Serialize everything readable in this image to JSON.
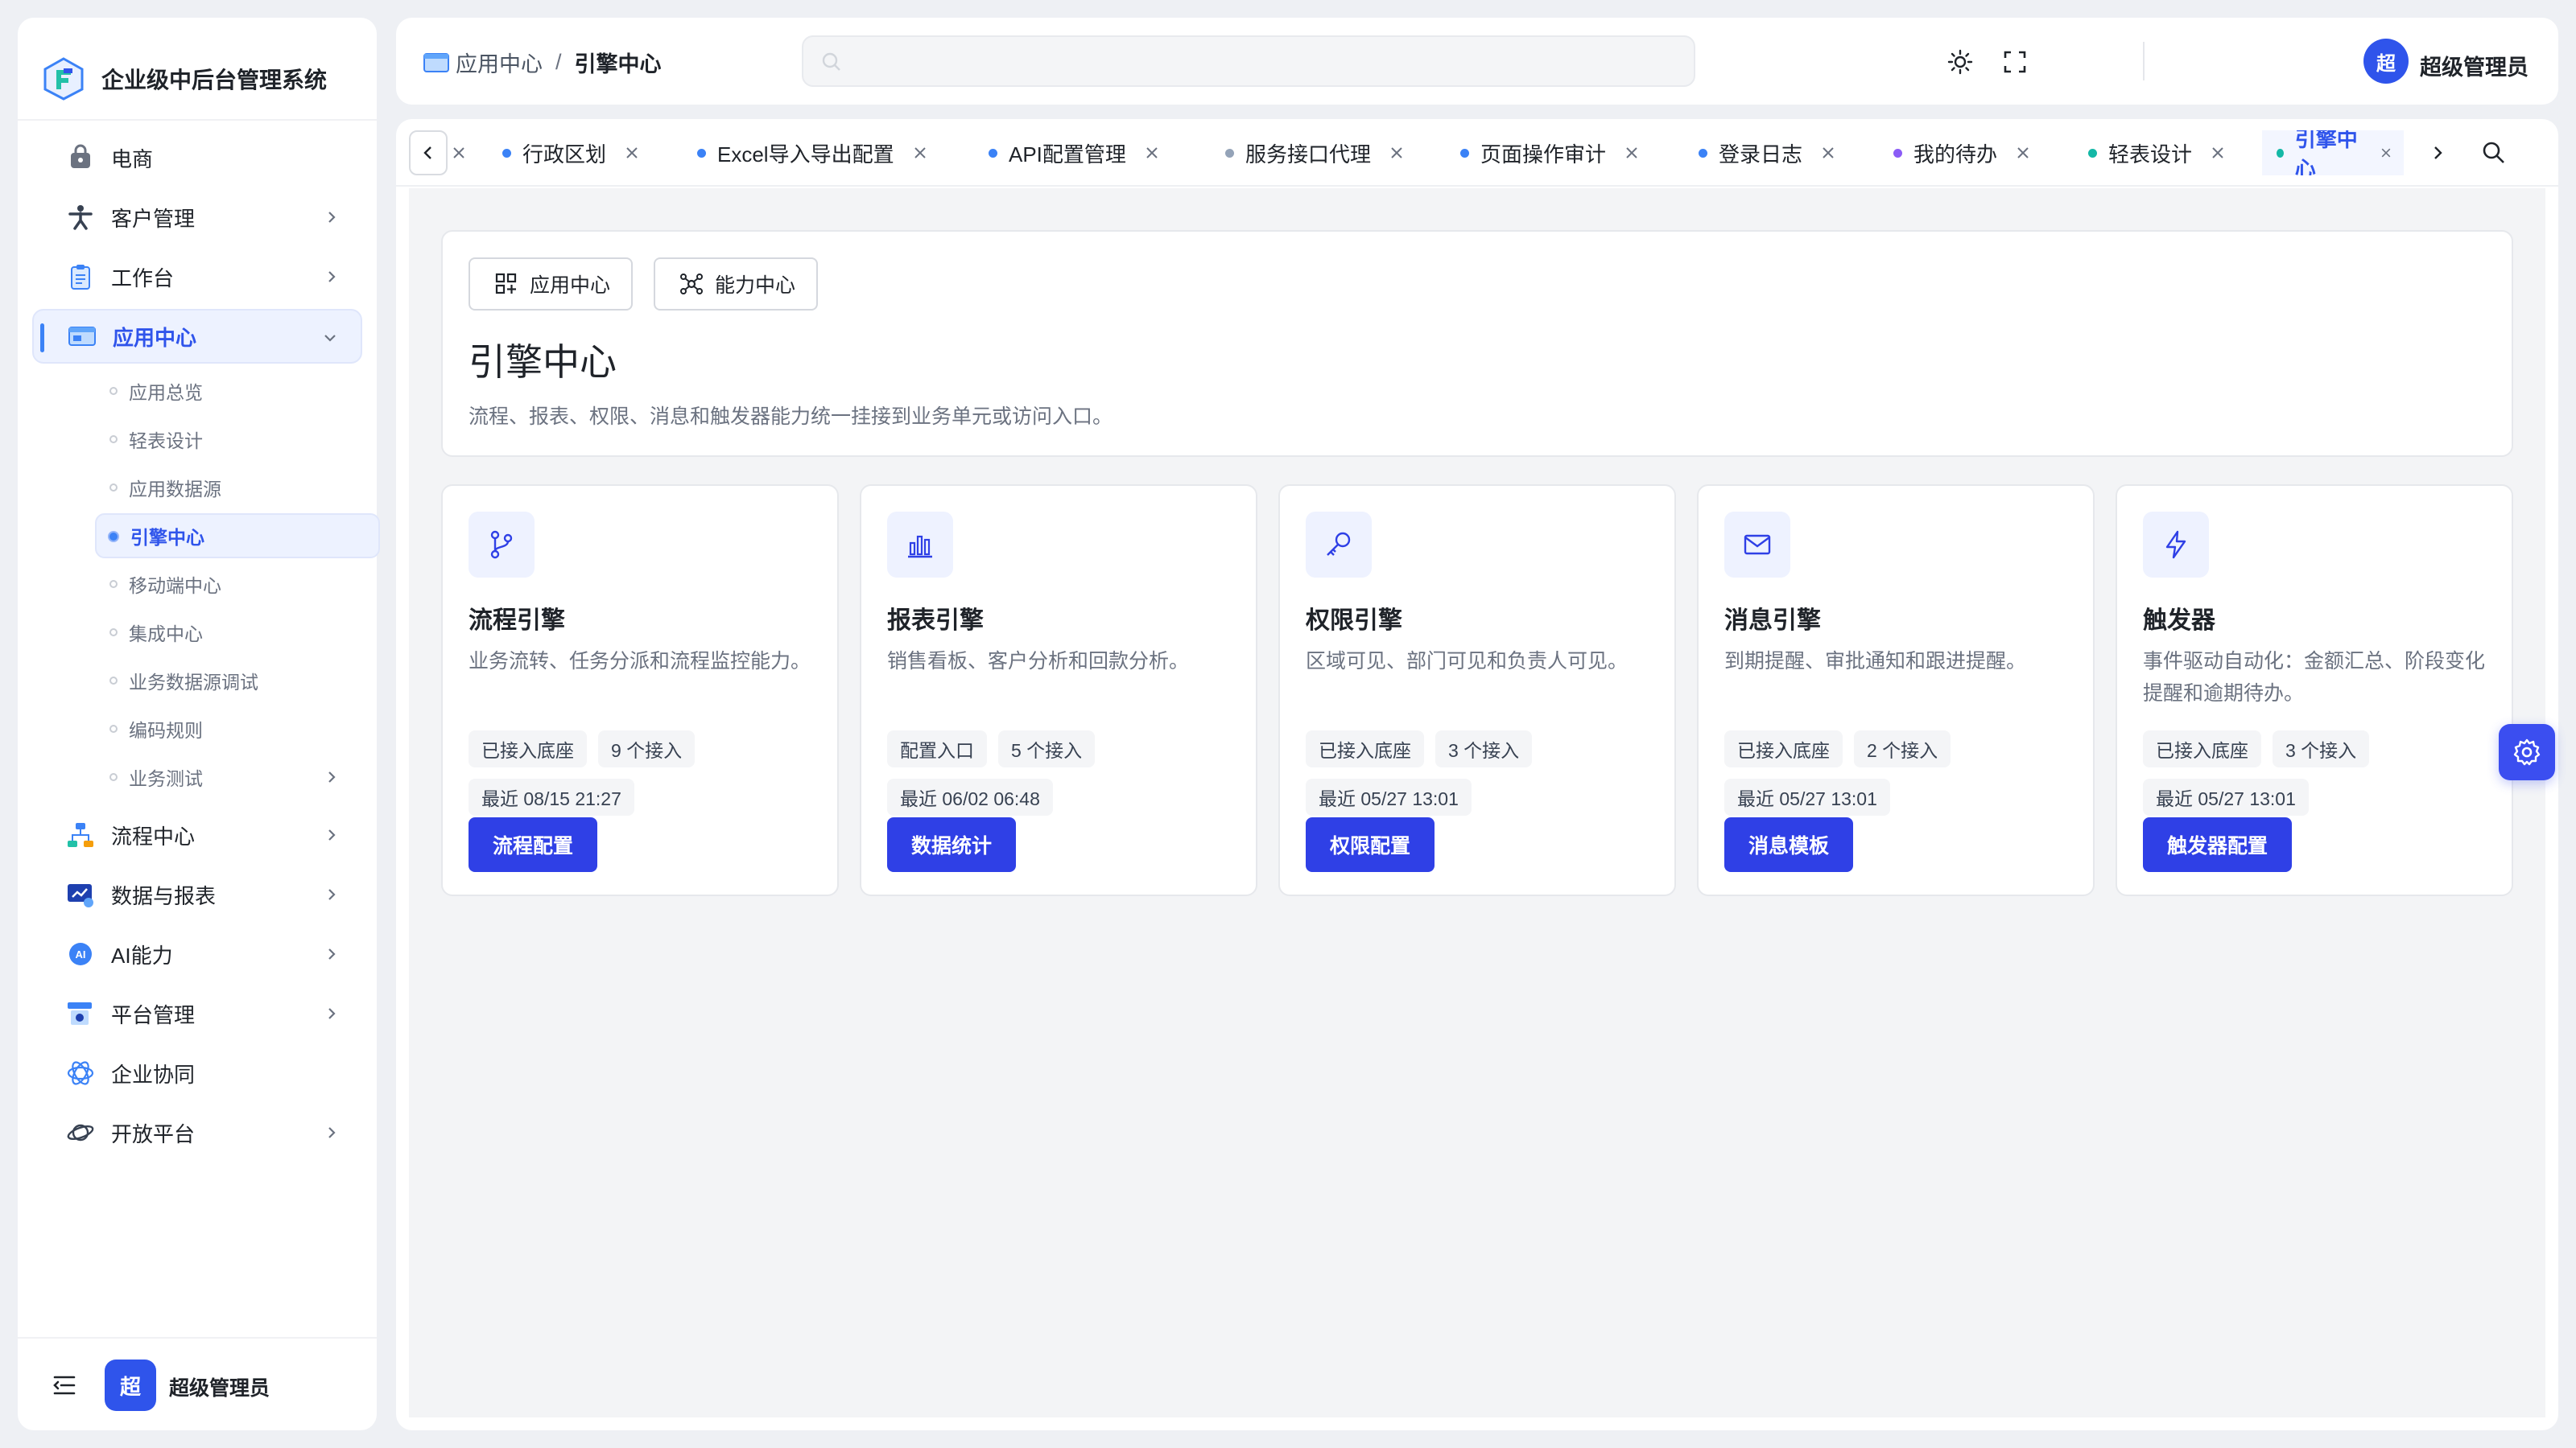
{
  "app": {
    "title": "企业级中后台管理系统"
  },
  "sidebar": {
    "items": [
      {
        "label": "电商",
        "icon": "shopping-bag-icon",
        "chevron": false
      },
      {
        "label": "客户管理",
        "icon": "person-icon",
        "chevron": true
      },
      {
        "label": "工作台",
        "icon": "clipboard-icon",
        "chevron": true
      },
      {
        "label": "应用中心",
        "icon": "app-window-icon",
        "chevron": true,
        "active": true
      }
    ],
    "subitems": [
      {
        "label": "应用总览"
      },
      {
        "label": "轻表设计"
      },
      {
        "label": "应用数据源"
      },
      {
        "label": "引擎中心",
        "active": true
      },
      {
        "label": "移动端中心"
      },
      {
        "label": "集成中心"
      },
      {
        "label": "业务数据源调试"
      },
      {
        "label": "编码规则"
      },
      {
        "label": "业务测试",
        "chevron": true
      }
    ],
    "items2": [
      {
        "label": "流程中心",
        "icon": "flow-icon"
      },
      {
        "label": "数据与报表",
        "icon": "report-icon"
      },
      {
        "label": "AI能力",
        "icon": "ai-icon"
      },
      {
        "label": "平台管理",
        "icon": "platform-icon"
      },
      {
        "label": "企业协同",
        "icon": "collab-icon",
        "nochevron": true
      },
      {
        "label": "开放平台",
        "icon": "planet-icon"
      }
    ],
    "footer": {
      "avatar": "超",
      "user": "超级管理员"
    }
  },
  "header": {
    "breadcrumb": {
      "parent": "应用中心",
      "separator": "/",
      "current": "引擎中心"
    },
    "search": {
      "placeholder": ""
    },
    "avatar": "超",
    "user": "超级管理员"
  },
  "tabs": [
    {
      "label": "行政区划",
      "color": "#3b82f6"
    },
    {
      "label": "Excel导入导出配置",
      "color": "#3b82f6"
    },
    {
      "label": "API配置管理",
      "color": "#3b82f6"
    },
    {
      "label": "服务接口代理",
      "color": "#94a3b8"
    },
    {
      "label": "页面操作审计",
      "color": "#3b82f6"
    },
    {
      "label": "登录日志",
      "color": "#3b82f6"
    },
    {
      "label": "我的待办",
      "color": "#8b5cf6"
    },
    {
      "label": "轻表设计",
      "color": "#14b8a6"
    },
    {
      "label": "引擎中心",
      "color": "#14b8a6",
      "active": true
    }
  ],
  "intro": {
    "btn_app": "应用中心",
    "btn_capability": "能力中心",
    "title": "引擎中心",
    "desc": "流程、报表、权限、消息和触发器能力统一挂接到业务单元或访问入口。"
  },
  "engines": [
    {
      "name": "流程引擎",
      "icon": "git-branch-icon",
      "desc": "业务流转、任务分派和流程监控能力。",
      "tag1": "已接入底座",
      "tag2": "9 个接入",
      "recent": "最近 08/15 21:27",
      "button": "流程配置"
    },
    {
      "name": "报表引擎",
      "icon": "bar-chart-icon",
      "desc": "销售看板、客户分析和回款分析。",
      "tag1": "配置入口",
      "tag2": "5 个接入",
      "recent": "最近 06/02 06:48",
      "button": "数据统计"
    },
    {
      "name": "权限引擎",
      "icon": "key-icon",
      "desc": "区域可见、部门可见和负责人可见。",
      "tag1": "已接入底座",
      "tag2": "3 个接入",
      "recent": "最近 05/27 13:01",
      "button": "权限配置"
    },
    {
      "name": "消息引擎",
      "icon": "mail-icon",
      "desc": "到期提醒、审批通知和跟进提醒。",
      "tag1": "已接入底座",
      "tag2": "2 个接入",
      "recent": "最近 05/27 13:01",
      "button": "消息模板"
    },
    {
      "name": "触发器",
      "icon": "lightning-icon",
      "desc": "事件驱动自动化：金额汇总、阶段变化提醒和逾期待办。",
      "tag1": "已接入底座",
      "tag2": "3 个接入",
      "recent": "最近 05/27 13:01",
      "button": "触发器配置"
    }
  ],
  "colors": {
    "primary": "#2f40e6",
    "accent": "#2f54eb",
    "active_bg": "#edf2ff"
  }
}
